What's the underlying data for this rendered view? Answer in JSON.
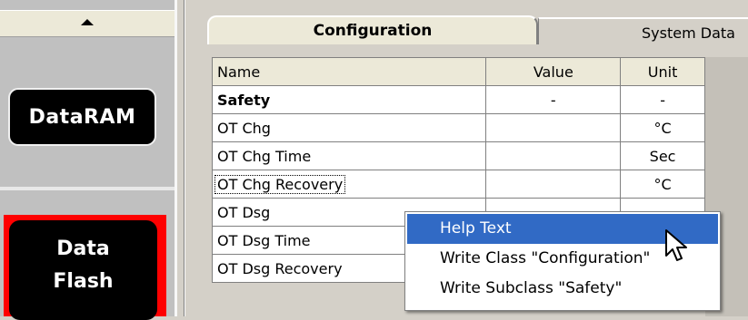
{
  "sidebar": {
    "buttons": [
      {
        "label": "DataRAM"
      },
      {
        "label_line1": "Data",
        "label_line2": "Flash"
      }
    ]
  },
  "tabs": [
    {
      "label": "Configuration",
      "active": true
    },
    {
      "label": "System Data",
      "visible_label": "System Data",
      "active": false
    }
  ],
  "table": {
    "headers": [
      "Name",
      "Value",
      "Unit"
    ],
    "rows": [
      {
        "name": "Safety",
        "value": "-",
        "unit": "-"
      },
      {
        "name": "OT Chg",
        "value": "",
        "unit": "°C"
      },
      {
        "name": "OT Chg Time",
        "value": "",
        "unit": "Sec"
      },
      {
        "name": "OT Chg Recovery",
        "value": "",
        "unit": "°C"
      },
      {
        "name": "OT Dsg",
        "value": "",
        "unit": ""
      },
      {
        "name": "OT Dsg Time",
        "value": "",
        "unit": ""
      },
      {
        "name": "OT Dsg Recovery",
        "value": "",
        "unit": ""
      }
    ]
  },
  "context_menu": {
    "items": [
      {
        "label": "Help Text",
        "highlighted": true
      },
      {
        "label": "Write Class \"Configuration\""
      },
      {
        "label": "Write Subclass \"Safety\""
      }
    ]
  },
  "colors": {
    "highlight": "#316ac5",
    "flash_border": "#ff0000",
    "button_bg": "#000000"
  },
  "icons": [
    "scroll-up-arrow-icon",
    "mouse-pointer-icon"
  ]
}
